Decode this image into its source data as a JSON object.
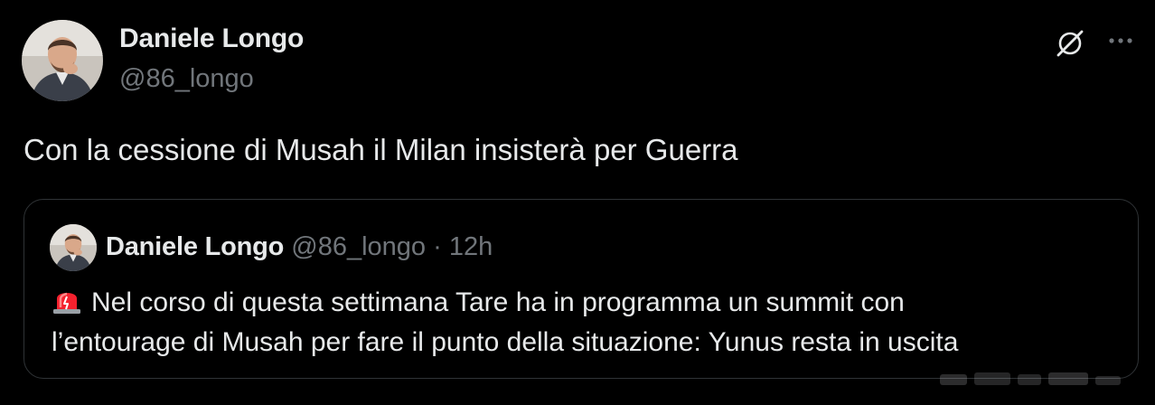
{
  "tweet": {
    "author_name": "Daniele Longo",
    "author_handle": "@86_longo",
    "text": "Con la cessione di Musah il Milan insisterà per Guerra",
    "avatar_icon": "profile-photo",
    "action_icons": [
      "grok-icon",
      "more-icon"
    ]
  },
  "quoted_tweet": {
    "author_name": "Daniele Longo",
    "author_handle": "@86_longo",
    "separator": "·",
    "time": "12h",
    "emoji_icon": "rotating-light-icon",
    "line1": "Nel corso di questa settimana Tare ha in programma un summit con",
    "line2": "l’entourage di Musah per fare il punto della situazione: Yunus resta in uscita"
  },
  "colors": {
    "background": "#000000",
    "primary_text": "#e7e9ea",
    "secondary_text": "#71767b",
    "border": "#2f3336"
  }
}
